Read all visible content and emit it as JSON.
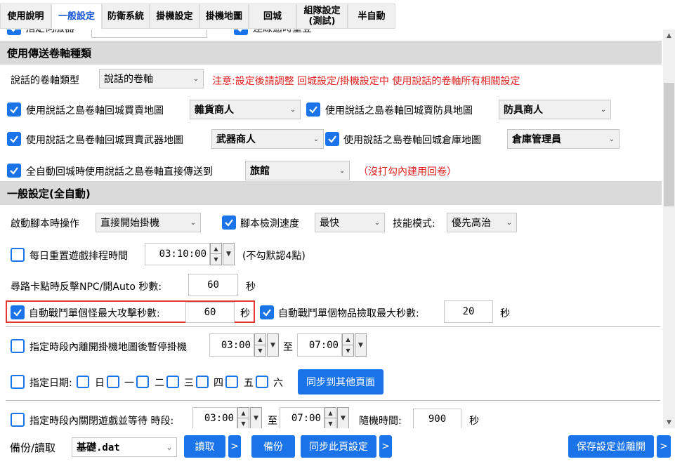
{
  "tabs": [
    {
      "label": "使用說明"
    },
    {
      "label": "一般設定",
      "active": true
    },
    {
      "label": "防衛系統"
    },
    {
      "label": "掛機設定"
    },
    {
      "label": "掛機地圖"
    },
    {
      "label": "回城"
    },
    {
      "label": "組隊設定\n(測試)"
    },
    {
      "label": "半自動"
    }
  ],
  "partial_row": {
    "left_text": "指定伺服器",
    "right_text": "連線逾時重登"
  },
  "scroll_section": {
    "title": "使用傳送卷軸種類",
    "scroll_type_label": "說話的卷軸類型",
    "scroll_type_value": "說話的卷軸",
    "warning": "注意:設定後請調整 回城設定/掛機設定中 使用說話的卷軸所有相關設定",
    "general_store_label": "使用說話之島卷軸回城買賣地圖",
    "general_store_value": "雜貨商人",
    "armor_store_label": "使用說話之島卷軸回城賣防具地圖",
    "armor_store_value": "防具商人",
    "weapon_store_label": "使用說話之島卷軸回城買賣武器地圖",
    "weapon_store_value": "武器商人",
    "warehouse_label": "使用說話之島卷軸回城倉庫地圖",
    "warehouse_value": "倉庫管理員",
    "auto_teleport_label": "全自動回城時使用說話之島卷軸直接傳送到",
    "auto_teleport_value": "旅館",
    "auto_teleport_note": "（沒打勾內建用回卷）"
  },
  "general_section": {
    "title": "一般設定(全自動)",
    "startup_label": "啟動腳本時操作",
    "startup_value": "直接開始掛機",
    "detect_speed_label": "腳本檢測速度",
    "detect_speed_value": "最快",
    "skill_mode_label": "技能模式:",
    "skill_mode_value": "優先高治",
    "daily_reset_label": "每日重置遊戲排程時間",
    "daily_reset_value": "03:10:00",
    "daily_reset_note": "(不勾默認4點)",
    "stuck_label": "尋路卡點時反擊NPC/開Auto 秒數:",
    "stuck_value": "60",
    "stuck_unit": "秒",
    "max_attack_label": "自動戰鬥單個怪最大攻擊秒數:",
    "max_attack_value": "60",
    "max_attack_unit": "秒",
    "max_pickup_label": "自動戰鬥單個物品撿取最大秒數:",
    "max_pickup_value": "20",
    "max_pickup_unit": "秒",
    "pause_label": "指定時段內離開掛機地圖後暫停掛機",
    "pause_start": "03:00",
    "pause_to": "至",
    "pause_end": "07:00",
    "date_label": "指定日期:",
    "days": [
      "日",
      "一",
      "二",
      "三",
      "四",
      "五",
      "六"
    ],
    "sync_other_button": "同步到其他頁面",
    "close_game_label": "指定時段內關閉遊戲並等待 時段:",
    "close_start": "03:00",
    "close_to": "至",
    "close_end": "07:00",
    "random_label": "隨機時間:",
    "random_value": "900",
    "random_unit": "秒"
  },
  "bottom_bar": {
    "backup_label": "備份/讀取",
    "file_value": "基礎.dat",
    "read_button": "讀取",
    "backup_button": "備份",
    "sync_page_button": "同步此頁設定",
    "save_exit_button": "保存設定並離開",
    "more_glyph": ">"
  },
  "colors": {
    "accent": "#1a73e8",
    "warning": "#e02020",
    "section_bg": "#dadada",
    "highlight": "#e53935"
  }
}
